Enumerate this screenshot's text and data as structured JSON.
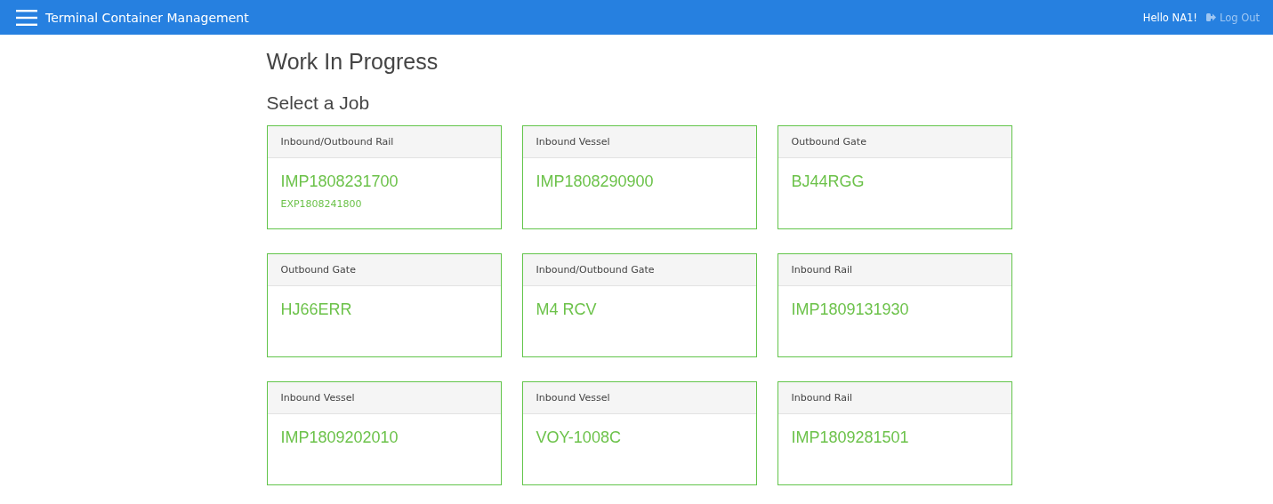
{
  "navbar": {
    "title": "Terminal Container Management",
    "greeting": "Hello NA1!",
    "logout": "Log Out"
  },
  "page_title": "Work In Progress",
  "section_title": "Select a Job",
  "jobs": [
    {
      "type": "Inbound/Outbound Rail",
      "reference": "IMP1808231700",
      "secondary_reference": "EXP1808241800"
    },
    {
      "type": "Inbound Vessel",
      "reference": "IMP1808290900"
    },
    {
      "type": "Outbound Gate",
      "reference": "BJ44RGG"
    },
    {
      "type": "Outbound Gate",
      "reference": "HJ66ERR"
    },
    {
      "type": "Inbound/Outbound Gate",
      "reference": "M4 RCV"
    },
    {
      "type": "Inbound Rail",
      "reference": "IMP1809131930"
    },
    {
      "type": "Inbound Vessel",
      "reference": "IMP1809202010"
    },
    {
      "type": "Inbound Vessel",
      "reference": "VOY-1008C"
    },
    {
      "type": "Inbound Rail",
      "reference": "IMP1809281501"
    }
  ]
}
